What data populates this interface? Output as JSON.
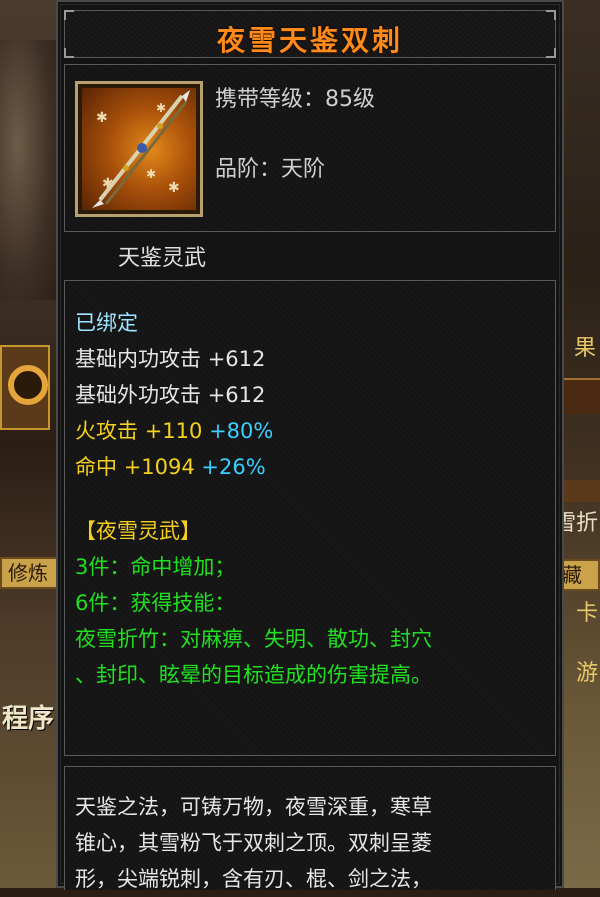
{
  "item": {
    "name": "夜雪天鉴双刺",
    "required_level": "携带等级：85级",
    "grade": "品阶：天阶",
    "category": "天鉴灵武",
    "bound": "已绑定",
    "stats": [
      {
        "label": "基础内功攻击",
        "value": "+612",
        "bonus": ""
      },
      {
        "label": "基础外功攻击",
        "value": "+612",
        "bonus": ""
      },
      {
        "label": "火攻击",
        "value": "+110",
        "bonus": "+80%"
      },
      {
        "label": "命中",
        "value": "+1094",
        "bonus": "+26%"
      }
    ],
    "set": {
      "name": "【夜雪灵武】",
      "bonus_3": "3件：命中增加；",
      "bonus_6": "6件：获得技能：",
      "skill_line1": "夜雪折竹：对麻痹、失明、散功、封穴",
      "skill_line2": "、封印、眩晕的目标造成的伤害提高。"
    },
    "description": {
      "line1": "天鉴之法，可铸万物，夜雪深重，寒草",
      "line2": "锥心，其雪粉飞于双刺之顶。双刺呈菱",
      "line3": "形，尖端锐刺，含有刃、棍、剑之法，"
    }
  },
  "background": {
    "left_tab": "修炼",
    "left_text": "程序",
    "right_tab": "藏",
    "right_text_1": "果",
    "right_text_2": "雪折",
    "right_text_3": "卡",
    "right_text_4": "游"
  },
  "colors": {
    "title": "#ff8a1a",
    "bound": "#9ee6ff",
    "fire_stat": "#f5d020",
    "bonus_percent": "#3ad0ff",
    "set_bonus": "#20e020"
  },
  "icons": {
    "item_icon": "twin-spear-icon"
  }
}
